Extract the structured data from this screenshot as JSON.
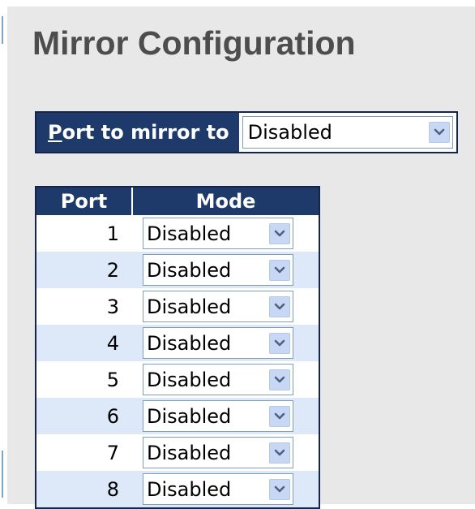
{
  "page": {
    "title": "Mirror Configuration"
  },
  "mirror": {
    "label_accesskey": "P",
    "label_rest": "ort to mirror to",
    "selected": "Disabled"
  },
  "table": {
    "headers": {
      "port": "Port",
      "mode": "Mode"
    },
    "rows": [
      {
        "port": "1",
        "mode": "Disabled"
      },
      {
        "port": "2",
        "mode": "Disabled"
      },
      {
        "port": "3",
        "mode": "Disabled"
      },
      {
        "port": "4",
        "mode": "Disabled"
      },
      {
        "port": "5",
        "mode": "Disabled"
      },
      {
        "port": "6",
        "mode": "Disabled"
      },
      {
        "port": "7",
        "mode": "Disabled"
      },
      {
        "port": "8",
        "mode": "Disabled"
      }
    ]
  },
  "icons": {
    "dropdown": "chevron-down-icon"
  },
  "colors": {
    "header_bg": "#1d3a6b",
    "header_border": "#14244a",
    "row_alt": "#dde8f8",
    "page_bg": "#e8e8e8",
    "title_text": "#4d4d4d"
  }
}
